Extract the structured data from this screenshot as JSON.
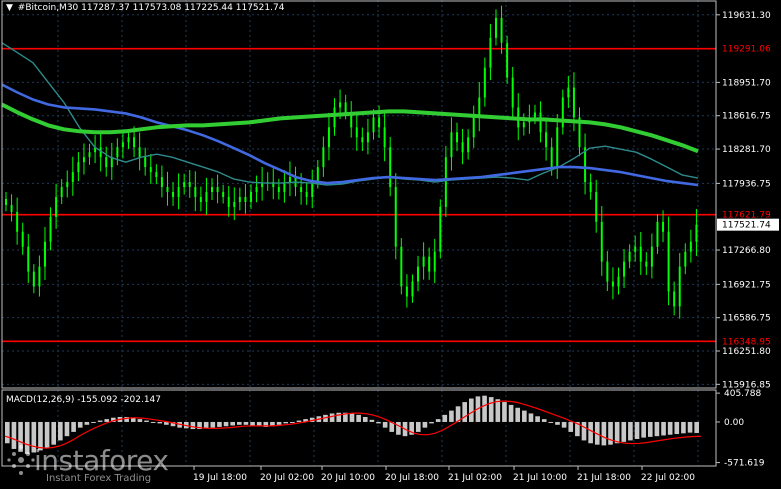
{
  "header": {
    "arrow": "▼",
    "symbol_timeframe": "#Bitcoin,M30",
    "ohlc": "117287.37 117573.08 117225.44 117521.74"
  },
  "price_axis": {
    "ticks": [
      "119631.30",
      "119291.06",
      "118951.70",
      "118616.75",
      "118281.70",
      "117936.75",
      "117621.79",
      "117521.74",
      "117266.80",
      "116921.75",
      "116586.75",
      "116348.95",
      "116251.80",
      "115916.85"
    ],
    "tick_values": [
      119631.3,
      119291.06,
      118951.7,
      118616.75,
      118281.7,
      117936.75,
      117621.79,
      117521.74,
      117266.8,
      116921.75,
      116586.75,
      116348.95,
      116251.8,
      115916.85
    ],
    "highlight_labels": [
      {
        "text": "119291.06",
        "value": 119291.06,
        "color": "#ff0000"
      },
      {
        "text": "117621.79",
        "value": 117621.79,
        "color": "#ff0000"
      },
      {
        "text": "116348.95",
        "value": 116348.95,
        "color": "#ff0000"
      }
    ],
    "current_price_label": "117521.74",
    "current_price": 117521.74,
    "range": [
      115880,
      119780
    ]
  },
  "levels": [
    {
      "name": "resistance",
      "value": 119291.06,
      "color": "#ff0000"
    },
    {
      "name": "middle",
      "value": 117621.79,
      "color": "#ff0000"
    },
    {
      "name": "support",
      "value": 116348.95,
      "color": "#ff0000"
    }
  ],
  "time_axis": {
    "labels": [
      "19 Jul 18:00",
      "20 Jul 02:00",
      "20 Jul 10:00",
      "20 Jul 18:00",
      "21 Jul 02:00",
      "21 Jul 10:00",
      "21 Jul 18:00",
      "22 Jul 02:00"
    ]
  },
  "macd": {
    "title": "MACD(12,26,9) -155.092 -202.147",
    "ticks": [
      "405.788",
      "0.00",
      "-571.619"
    ],
    "tick_values": [
      405.788,
      0,
      -571.619
    ],
    "range": [
      -620,
      450
    ]
  },
  "colors": {
    "background": "#000000",
    "grid": "#1e3a5a",
    "candles": "#00ff00",
    "ma_fast": "#2e8b8b",
    "ma_mid": "#4169e1",
    "ma_slow": "#32cd32",
    "level": "#ff0000",
    "macd_hist": "#c8c8c8",
    "macd_signal": "#ff0000"
  },
  "branding": {
    "name": "instaforex",
    "tagline": "Instant Forex Trading"
  },
  "chart_data": {
    "type": "candlestick",
    "title": "#Bitcoin,M30",
    "ylim": [
      115880,
      119780
    ],
    "close_series": [
      117720,
      117650,
      117450,
      117300,
      117050,
      116900,
      117100,
      117350,
      117600,
      117800,
      117900,
      117950,
      118050,
      118150,
      118200,
      118250,
      118300,
      118200,
      118100,
      118200,
      118300,
      118350,
      118400,
      118300,
      118200,
      118100,
      118050,
      118000,
      117900,
      117850,
      117800,
      117900,
      117950,
      117900,
      117800,
      117750,
      117850,
      117900,
      117850,
      117800,
      117700,
      117750,
      117800,
      117750,
      117850,
      117900,
      117950,
      117950,
      117900,
      117850,
      117950,
      118000,
      117900,
      117850,
      117800,
      117950,
      118100,
      118300,
      118500,
      118700,
      118750,
      118650,
      118500,
      118400,
      118350,
      118450,
      118600,
      118500,
      118300,
      117900,
      117300,
      116900,
      116800,
      116950,
      117100,
      117200,
      117050,
      117250,
      117700,
      118200,
      118450,
      118350,
      118250,
      118400,
      118600,
      118800,
      119100,
      119400,
      119600,
      119350,
      119000,
      118700,
      118500,
      118550,
      118600,
      118650,
      118450,
      118300,
      118100,
      118500,
      118800,
      118900,
      118600,
      118300,
      117950,
      117850,
      117550,
      117150,
      116950,
      116900,
      117000,
      117150,
      117250,
      117300,
      117150,
      117100,
      117300,
      117550,
      117450,
      116850,
      116700,
      117100,
      117250,
      117350,
      117521.74
    ],
    "series": [
      {
        "name": "MA fast",
        "values": [
          119350,
          119250,
          119150,
          118950,
          118750,
          118500,
          118300,
          118200,
          118150,
          118200,
          118230,
          118200,
          118150,
          118100,
          118050,
          117980,
          117950,
          117940,
          117940,
          117950,
          117940,
          117920,
          117930,
          117960,
          117980,
          118000,
          117980,
          117970,
          117950,
          117970,
          117980,
          117990,
          118000,
          117990,
          117970,
          118040,
          118100,
          118190,
          118290,
          118310,
          118280,
          118250,
          118180,
          118100,
          118020,
          117990
        ]
      },
      {
        "name": "MA mid",
        "values": [
          118930,
          118850,
          118780,
          118730,
          118700,
          118690,
          118680,
          118660,
          118640,
          118600,
          118550,
          118510,
          118470,
          118420,
          118360,
          118290,
          118220,
          118140,
          118070,
          118000,
          117960,
          117940,
          117950,
          117970,
          117990,
          118000,
          117990,
          117980,
          117970,
          117980,
          117990,
          118000,
          118020,
          118040,
          118060,
          118080,
          118100,
          118100,
          118090,
          118070,
          118050,
          118020,
          117990,
          117960,
          117940,
          117920
        ]
      },
      {
        "name": "MA slow",
        "values": [
          118730,
          118650,
          118580,
          118520,
          118480,
          118460,
          118450,
          118450,
          118460,
          118480,
          118500,
          118510,
          118520,
          118520,
          118530,
          118540,
          118550,
          118570,
          118590,
          118600,
          118610,
          118620,
          118630,
          118640,
          118650,
          118660,
          118660,
          118650,
          118640,
          118630,
          118620,
          118610,
          118600,
          118590,
          118580,
          118580,
          118570,
          118560,
          118550,
          118530,
          118500,
          118460,
          118420,
          118370,
          118320,
          118260
        ]
      }
    ],
    "macd_histogram": [
      -300,
      -380,
      -420,
      -450,
      -430,
      -400,
      -360,
      -320,
      -260,
      -200,
      -140,
      -80,
      -40,
      -10,
      20,
      40,
      60,
      70,
      70,
      60,
      40,
      20,
      0,
      -20,
      -40,
      -60,
      -80,
      -90,
      -100,
      -100,
      -90,
      -80,
      -70,
      -60,
      -50,
      -40,
      -40,
      -50,
      -60,
      -70,
      -60,
      -40,
      -20,
      0,
      20,
      40,
      60,
      80,
      100,
      120,
      130,
      130,
      120,
      100,
      70,
      30,
      -20,
      -80,
      -140,
      -180,
      -200,
      -180,
      -140,
      -80,
      -20,
      40,
      100,
      160,
      220,
      280,
      330,
      360,
      370,
      350,
      320,
      280,
      240,
      200,
      160,
      120,
      80,
      40,
      0,
      -40,
      -80,
      -140,
      -200,
      -260,
      -300,
      -320,
      -330,
      -320,
      -300,
      -280,
      -260,
      -240,
      -220,
      -210,
      -200,
      -190,
      -180,
      -170,
      -160,
      -150,
      -155
    ],
    "macd_signal": [
      -200,
      -230,
      -270,
      -310,
      -340,
      -360,
      -370,
      -360,
      -340,
      -300,
      -250,
      -190,
      -140,
      -90,
      -50,
      -10,
      20,
      40,
      55,
      60,
      55,
      45,
      30,
      15,
      0,
      -20,
      -40,
      -60,
      -75,
      -85,
      -90,
      -90,
      -85,
      -80,
      -70,
      -60,
      -55,
      -55,
      -55,
      -55,
      -50,
      -40,
      -30,
      -15,
      0,
      20,
      40,
      60,
      80,
      100,
      115,
      125,
      125,
      115,
      95,
      65,
      25,
      -20,
      -70,
      -120,
      -160,
      -180,
      -180,
      -160,
      -120,
      -70,
      -10,
      50,
      110,
      170,
      220,
      260,
      285,
      295,
      290,
      275,
      250,
      220,
      190,
      155,
      120,
      85,
      50,
      10,
      -30,
      -80,
      -130,
      -180,
      -225,
      -260,
      -285,
      -300,
      -305,
      -300,
      -290,
      -275,
      -260,
      -245,
      -230,
      -220,
      -210,
      -205,
      -202
    ]
  }
}
